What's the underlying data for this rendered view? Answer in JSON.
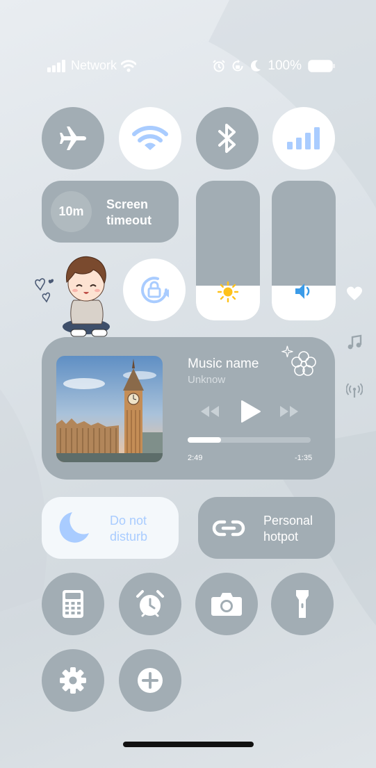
{
  "status_bar": {
    "network_label": "Network",
    "battery_percent": "100%",
    "icons": [
      "signal-icon",
      "wifi-icon",
      "alarm-icon",
      "rotation-lock-icon",
      "moon-icon",
      "battery-icon"
    ]
  },
  "toggles": [
    {
      "name": "airplane-mode",
      "icon": "airplane-icon",
      "active": false
    },
    {
      "name": "wifi",
      "icon": "wifi-icon",
      "active": true
    },
    {
      "name": "bluetooth",
      "icon": "bluetooth-icon",
      "active": false
    },
    {
      "name": "cellular",
      "icon": "signal-icon",
      "active": true
    }
  ],
  "screen_timeout": {
    "value": "10m",
    "line1": "Screen",
    "line2": "timeout"
  },
  "rotation_lock": {
    "icon": "rotation-lock-icon",
    "active": true
  },
  "brightness": {
    "level": 0.25,
    "icon": "sun-icon"
  },
  "volume": {
    "level": 0.25,
    "icon": "speaker-icon"
  },
  "side_icons": [
    "heart-icon",
    "music-note-icon",
    "broadcast-icon"
  ],
  "media": {
    "title": "Music name",
    "artist": "Unknow",
    "elapsed": "2:49",
    "remaining": "-1:35",
    "progress": 0.27
  },
  "do_not_disturb": {
    "line1": "Do not",
    "line2": "disturb",
    "icon": "moon-icon",
    "active": true
  },
  "hotspot": {
    "line1": "Personal",
    "line2": "hotpot",
    "icon": "link-icon",
    "active": false
  },
  "shortcuts": [
    {
      "name": "calculator",
      "icon": "calculator-icon"
    },
    {
      "name": "alarm",
      "icon": "alarm-clock-icon"
    },
    {
      "name": "camera",
      "icon": "camera-icon"
    },
    {
      "name": "flashlight",
      "icon": "flashlight-icon"
    },
    {
      "name": "settings",
      "icon": "gear-icon"
    },
    {
      "name": "add",
      "icon": "plus-icon"
    }
  ],
  "colors": {
    "tile": "#a2adb4",
    "accent": "#a9ccff",
    "white": "#ffffff",
    "sun": "#ffc21a",
    "speaker": "#3b9be8"
  }
}
